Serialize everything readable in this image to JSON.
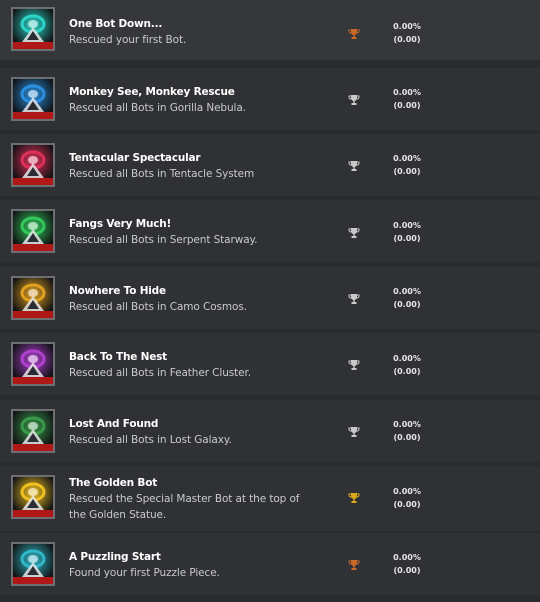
{
  "colors": {
    "bronze": "#c8692a",
    "silver": "#c9c9c9",
    "gold": "#d9a91a",
    "background": "#2f3134"
  },
  "achievements": [
    {
      "title": "One Bot Down...",
      "description": "Rescued your first Bot.",
      "trophy": "bronze",
      "icon": "first-bot-icon",
      "percent": "0.00%",
      "points": "(0.00)",
      "theme": "#2bd6c8"
    },
    {
      "title": "Monkey See, Monkey Rescue",
      "description": "Rescued all Bots in Gorilla Nebula.",
      "trophy": "silver",
      "icon": "gorilla-nebula-icon",
      "percent": "0.00%",
      "points": "(0.00)",
      "theme": "#2a8fe0"
    },
    {
      "title": "Tentacular Spectacular",
      "description": "Rescued all Bots in Tentacle System",
      "trophy": "silver",
      "icon": "tentacle-system-icon",
      "percent": "0.00%",
      "points": "(0.00)",
      "theme": "#e0305a"
    },
    {
      "title": "Fangs Very Much!",
      "description": "Rescued all Bots in Serpent Starway.",
      "trophy": "silver",
      "icon": "serpent-starway-icon",
      "percent": "0.00%",
      "points": "(0.00)",
      "theme": "#32c85a"
    },
    {
      "title": "Nowhere To Hide",
      "description": "Rescued all Bots in Camo Cosmos.",
      "trophy": "silver",
      "icon": "camo-cosmos-icon",
      "percent": "0.00%",
      "points": "(0.00)",
      "theme": "#e0a020"
    },
    {
      "title": "Back To The Nest",
      "description": "Rescued all Bots in Feather Cluster.",
      "trophy": "silver",
      "icon": "feather-cluster-icon",
      "percent": "0.00%",
      "points": "(0.00)",
      "theme": "#b040d0"
    },
    {
      "title": "Lost And Found",
      "description": "Rescued all Bots in Lost Galaxy.",
      "trophy": "silver",
      "icon": "lost-galaxy-icon",
      "percent": "0.00%",
      "points": "(0.00)",
      "theme": "#3a9a4a"
    },
    {
      "title": "The Golden Bot",
      "description": "Rescued the Special Master Bot at the top of the Golden Statue.",
      "trophy": "gold",
      "icon": "golden-bot-icon",
      "percent": "0.00%",
      "points": "(0.00)",
      "theme": "#f0c020"
    },
    {
      "title": "A Puzzling Start",
      "description": "Found your first Puzzle Piece.",
      "trophy": "bronze",
      "icon": "puzzle-piece-icon",
      "percent": "0.00%",
      "points": "(0.00)",
      "theme": "#30b8c8"
    }
  ]
}
